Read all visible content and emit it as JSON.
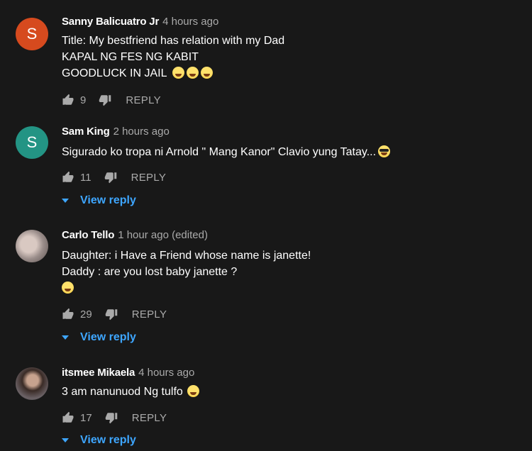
{
  "colors": {
    "background": "#181818",
    "text": "#ffffff",
    "muted": "#aaaaaa",
    "link": "#3ea6ff",
    "avatar_s_red": "#d64a1e",
    "avatar_s_teal": "#239484"
  },
  "comments": [
    {
      "author": "Sanny Balicuatro Jr",
      "time": "4 hours ago",
      "avatar_letter": "S",
      "lines": [
        "Title: My bestfriend has relation with my Dad",
        "KAPAL NG FES NG KABIT",
        "GOODLUCK IN JAIL"
      ],
      "likes": "9",
      "reply_label": "REPLY"
    },
    {
      "author": "Sam King",
      "time": "2 hours ago",
      "avatar_letter": "S",
      "lines": [
        "Sigurado ko tropa ni Arnold \" Mang Kanor\" Clavio yung Tatay..."
      ],
      "likes": "11",
      "reply_label": "REPLY",
      "view_reply": "View reply"
    },
    {
      "author": "Carlo Tello",
      "time": "1 hour ago (edited)",
      "lines": [
        "Daughter: i Have a Friend whose name is janette!",
        "Daddy : are you lost baby janette  ?"
      ],
      "likes": "29",
      "reply_label": "REPLY",
      "view_reply": "View reply"
    },
    {
      "author": "itsmee Mikaela",
      "time": "4 hours ago",
      "lines": [
        "3 am nanunuod Ng tulfo"
      ],
      "likes": "17",
      "reply_label": "REPLY",
      "view_reply": "View reply"
    }
  ]
}
